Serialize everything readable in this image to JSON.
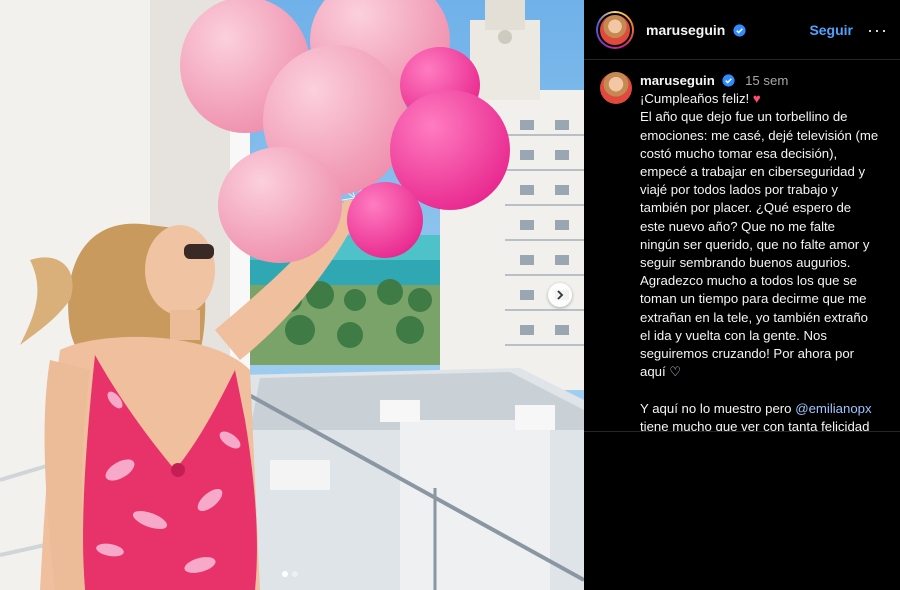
{
  "post": {
    "username": "maruseguin",
    "follow_label": "Seguir",
    "more_label": "···",
    "time_ago": "15 sem",
    "caption_lines": [
      "El año que dejo fue un torbellino de",
      "emociones: me casé, dejé televisión (me",
      "costó mucho tomar esa decisión),",
      "empecé a trabajar en ciberseguridad y",
      "viajé por todos lados por trabajo y",
      "también por placer. ¿Qué espero de",
      "este nuevo año? Que no me falte",
      "ningún ser querido, que no falte amor y",
      "seguir sembrando buenos augurios.",
      "Agradezco mucho a todos los que se",
      "toman un tiempo para decirme que me",
      "extrañan en la tele, yo también extraño",
      "el ida y vuelta con la gente. Nos",
      "seguiremos cruzando! Por ahora por"
    ],
    "first_line": "¡Cumpleaños feliz!",
    "aqui": "aquí",
    "line_pre_mention": "Y aquí no lo muestro pero",
    "mention": "@emilianopx",
    "last_line": "tiene mucho que ver con tanta felicidad",
    "carousel_dots": 2,
    "active_dot": 0
  },
  "colors": {
    "follow": "#4da3ff",
    "mention": "#9ec4ff",
    "swimsuit": "#e8336a",
    "balloons": "#f7a6bf"
  },
  "icons": [
    "verified-badge-icon",
    "more-options-icon",
    "chevron-right-icon",
    "heart-emoji-icon"
  ]
}
